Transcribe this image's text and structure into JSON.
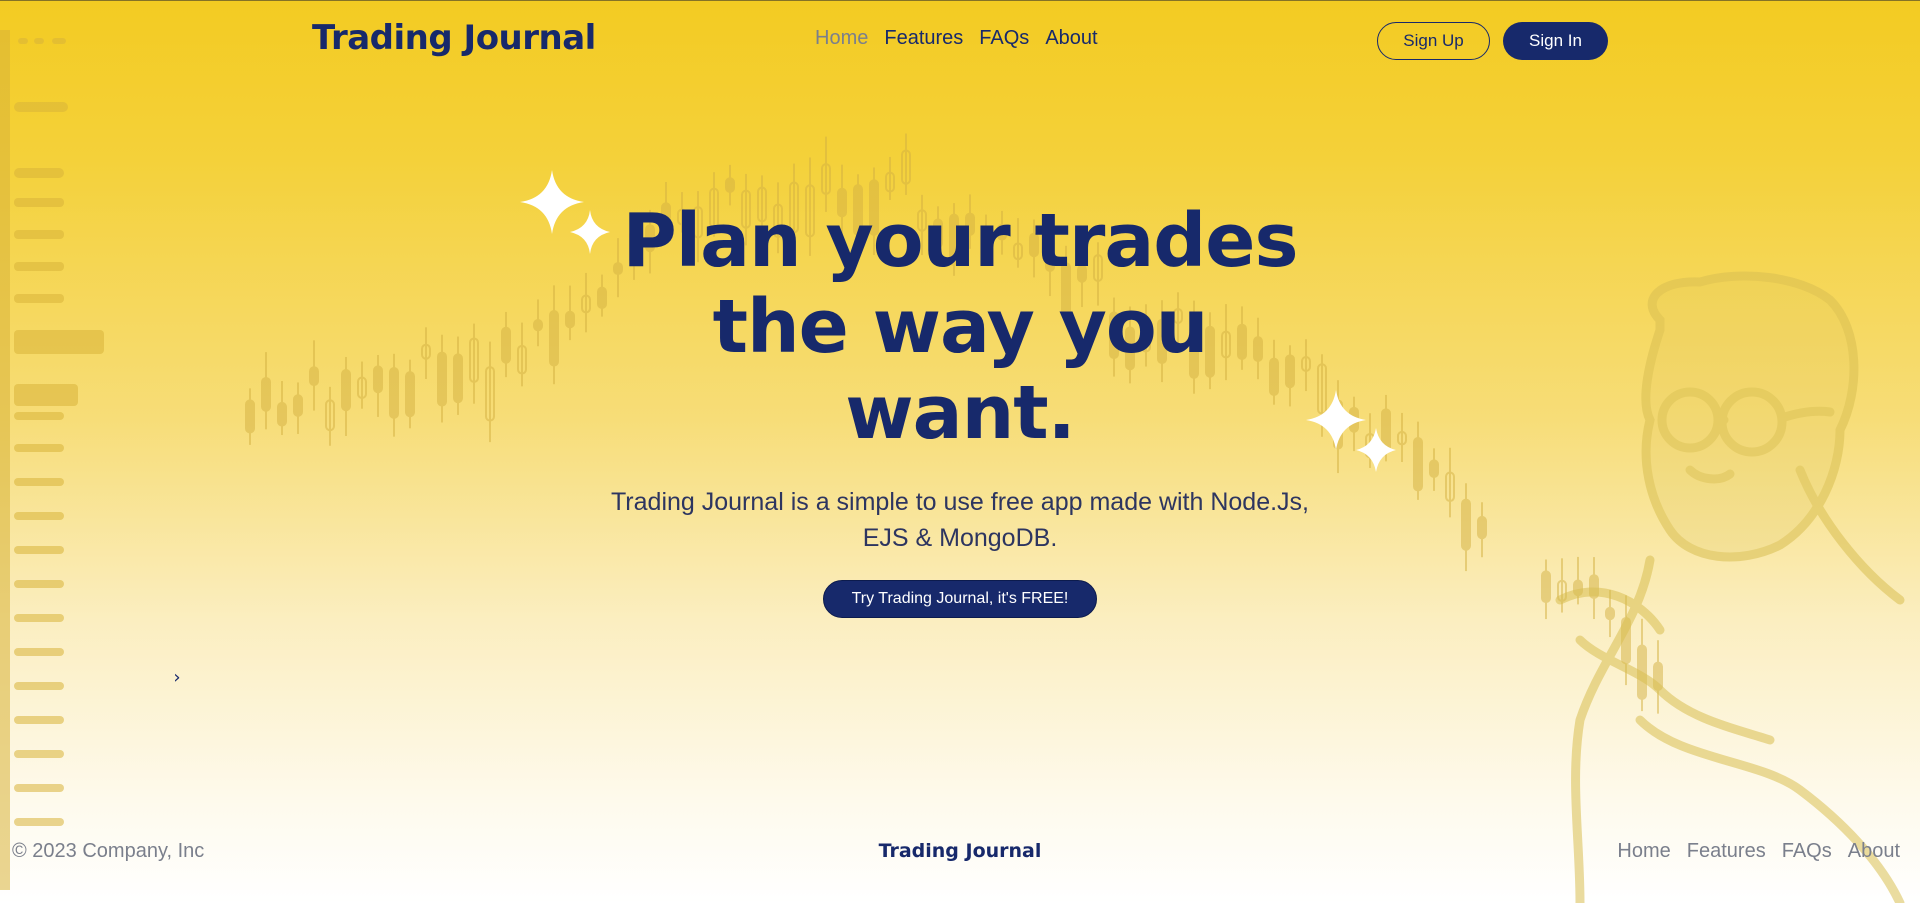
{
  "header": {
    "brand": "Trading Journal",
    "nav": [
      {
        "label": "Home",
        "active": true
      },
      {
        "label": "Features"
      },
      {
        "label": "FAQs"
      },
      {
        "label": "About"
      }
    ],
    "sign_up_label": "Sign Up",
    "sign_in_label": "Sign In"
  },
  "hero": {
    "title_line1": "Plan your trades",
    "title_line2": "the way you",
    "title_line3": "want.",
    "subtitle_line1": "Trading Journal is a simple to use free app made with Node.Js,",
    "subtitle_line2": "EJS & MongoDB.",
    "cta_label": "Try Trading Journal, it's FREE!",
    "carousel_next_icon": "chevron-right-icon",
    "decorations": [
      "sparkle-icon",
      "candlestick-chart-illustration",
      "person-illustration"
    ]
  },
  "footer": {
    "copyright": "© 2023 Company, Inc",
    "brand": "Trading Journal",
    "nav": [
      {
        "label": "Home"
      },
      {
        "label": "Features"
      },
      {
        "label": "FAQs"
      },
      {
        "label": "About"
      }
    ]
  },
  "colors": {
    "brand_navy": "#17296b",
    "accent_yellow": "#f3cb22",
    "muted_text": "#7a7f8c",
    "sparkle": "#ffffff"
  }
}
